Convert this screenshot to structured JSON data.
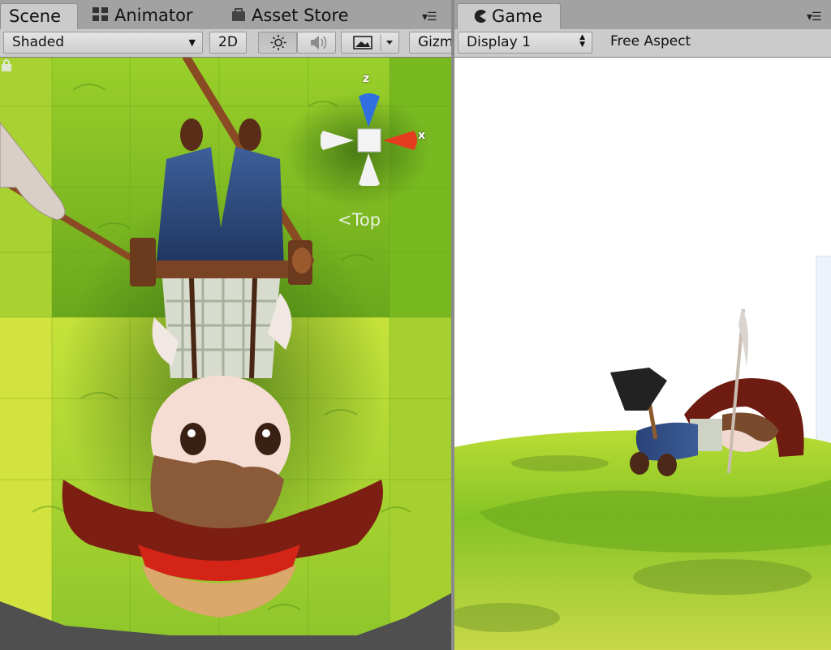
{
  "scene_panel": {
    "tabs": [
      {
        "label": "Scene",
        "icon": "scene-icon",
        "active": true
      },
      {
        "label": "Animator",
        "icon": "animator-icon",
        "active": false
      },
      {
        "label": "Asset Store",
        "icon": "store-icon",
        "active": false
      }
    ],
    "toolbar": {
      "shading_mode": "Shaded",
      "mode_2d": "2D",
      "lighting_icon": "sun-icon",
      "audio_icon": "speaker-icon",
      "effects_icon": "image-icon",
      "gizmos_label": "Gizmos"
    },
    "view": {
      "gizmo_axes": {
        "z": "z",
        "x": "x"
      },
      "view_label": "Top"
    }
  },
  "game_panel": {
    "tabs": [
      {
        "label": "Game",
        "icon": "pacman-icon",
        "active": true
      }
    ],
    "toolbar": {
      "display": "Display 1",
      "aspect": "Free Aspect"
    }
  },
  "colors": {
    "tab_bar": "#a2a2a2",
    "toolbar": "#cbcbcb",
    "grass": "#7dbd22",
    "gizmo_z": "#2f6fe0",
    "gizmo_x": "#e53b1e"
  }
}
